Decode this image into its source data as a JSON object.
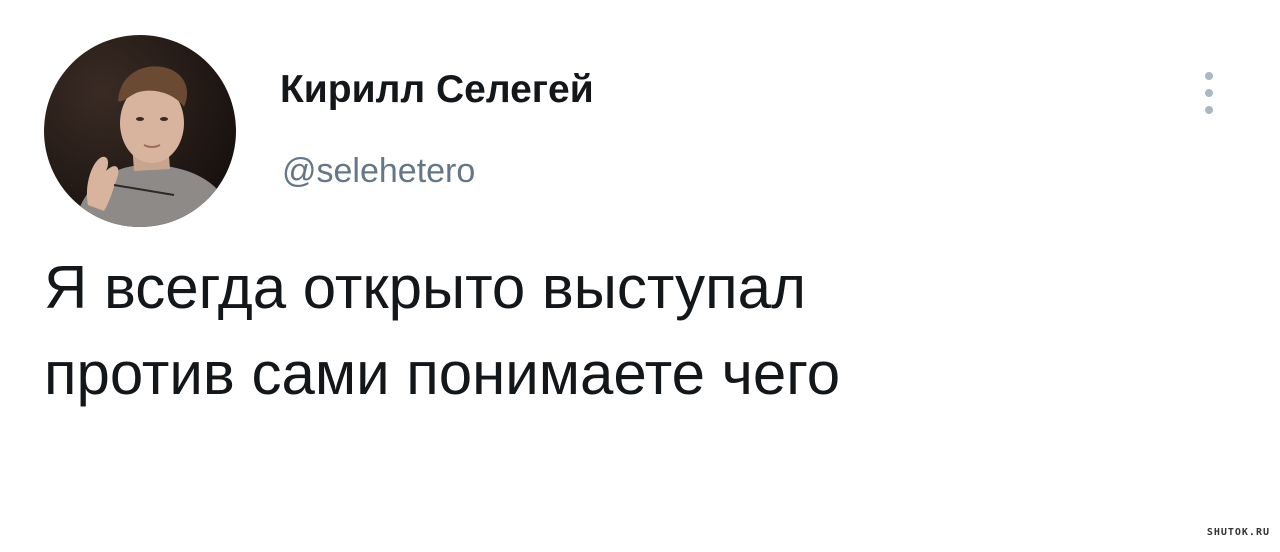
{
  "tweet": {
    "author": {
      "display_name": "Кирилл Селегей",
      "username": "@selehetero",
      "avatar_icon": "user-photo-avatar"
    },
    "more_icon": "more-vertical-icon",
    "text": "Я всегда открыто выступал\nпротив сами понимаете чего"
  },
  "watermark": {
    "text": "SHUTOK.RU"
  },
  "colors": {
    "background": "#ffffff",
    "text_primary": "#14171a",
    "text_secondary": "#657786",
    "icon_muted": "#aab8c2"
  }
}
